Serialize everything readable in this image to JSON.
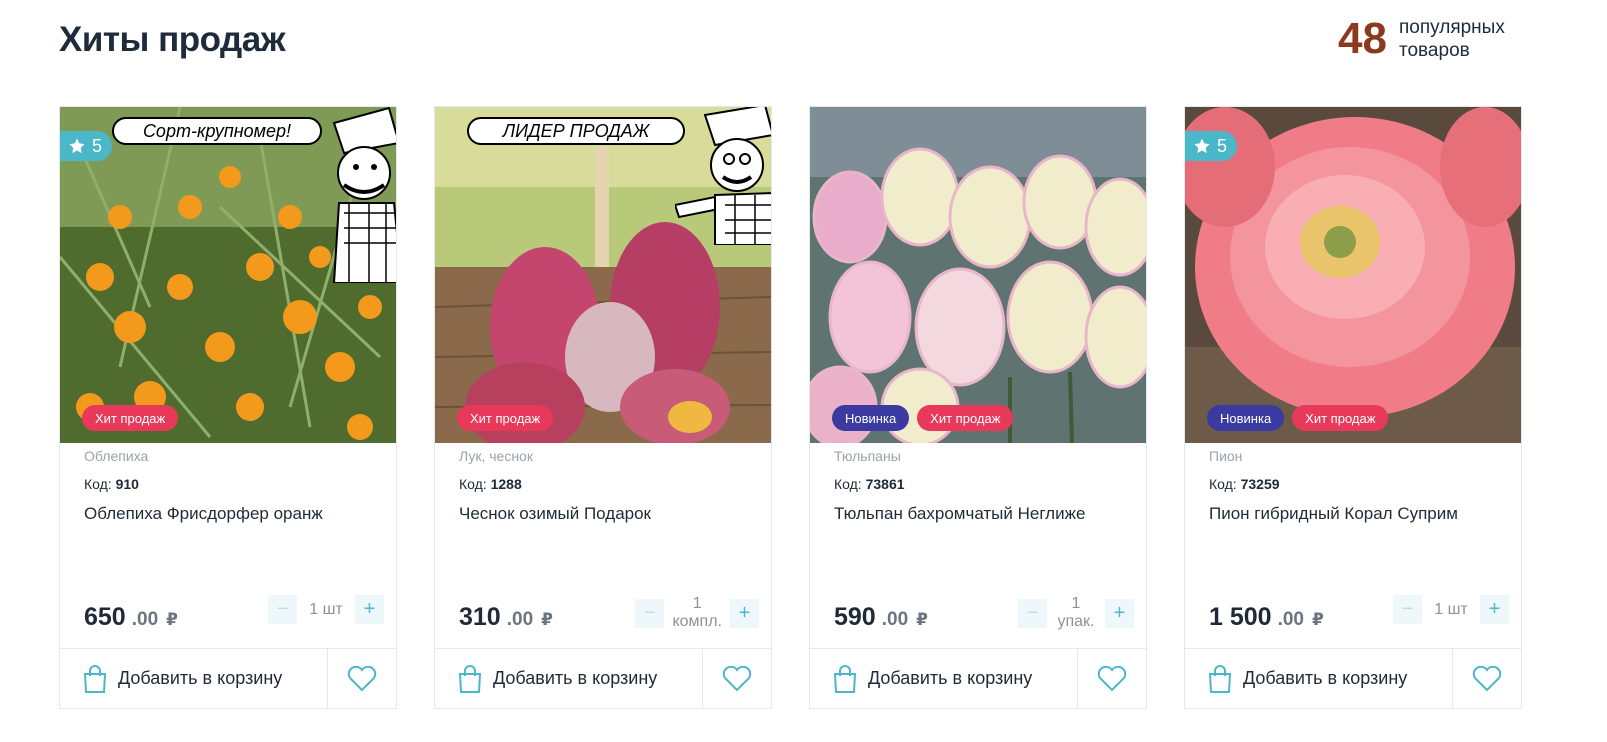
{
  "header": {
    "title": "Хиты продаж",
    "counter_value": "48",
    "counter_label": "популярных товаров"
  },
  "colors": {
    "accent": "#4ab8c8",
    "hit_badge": "#e8395a",
    "new_badge": "#3a3aa0",
    "counter": "#8b3a1e"
  },
  "products": [
    {
      "image_icon": "sea-buckthorn-photo",
      "rating": "5",
      "promo": "Сорт-крупномер!",
      "badges": {
        "hit": "Хит продаж"
      },
      "category": "Облепиха",
      "code_label": "Код:",
      "code": "910",
      "name": "Облепиха Фрисдорфер оранж",
      "price_int": "650",
      "price_dec": ".00",
      "currency": "₽",
      "qty": "1 шт",
      "cart_label": "Добавить в корзину"
    },
    {
      "image_icon": "garlic-photo",
      "promo": "ЛИДЕР ПРОДАЖ",
      "badges": {
        "hit": "Хит продаж"
      },
      "category": "Лук, чеснок",
      "code_label": "Код:",
      "code": "1288",
      "name": "Чеснок озимый Подарок",
      "price_int": "310",
      "price_dec": ".00",
      "currency": "₽",
      "qty_line1": "1",
      "qty_line2": "компл.",
      "cart_label": "Добавить в корзину"
    },
    {
      "image_icon": "tulip-photo",
      "badges": {
        "new": "Новинка",
        "hit": "Хит продаж"
      },
      "category": "Тюльпаны",
      "code_label": "Код:",
      "code": "73861",
      "name": "Тюльпан бахромчатый Неглиже",
      "price_int": "590",
      "price_dec": ".00",
      "currency": "₽",
      "qty_line1": "1",
      "qty_line2": "упак.",
      "cart_label": "Добавить в корзину"
    },
    {
      "image_icon": "peony-photo",
      "rating": "5",
      "badges": {
        "new": "Новинка",
        "hit": "Хит продаж"
      },
      "category": "Пион",
      "code_label": "Код:",
      "code": "73259",
      "name": "Пион гибридный Корал Суприм",
      "price_int": "1 500",
      "price_dec": ".00",
      "currency": "₽",
      "qty": "1 шт",
      "cart_label": "Добавить в корзину"
    }
  ]
}
